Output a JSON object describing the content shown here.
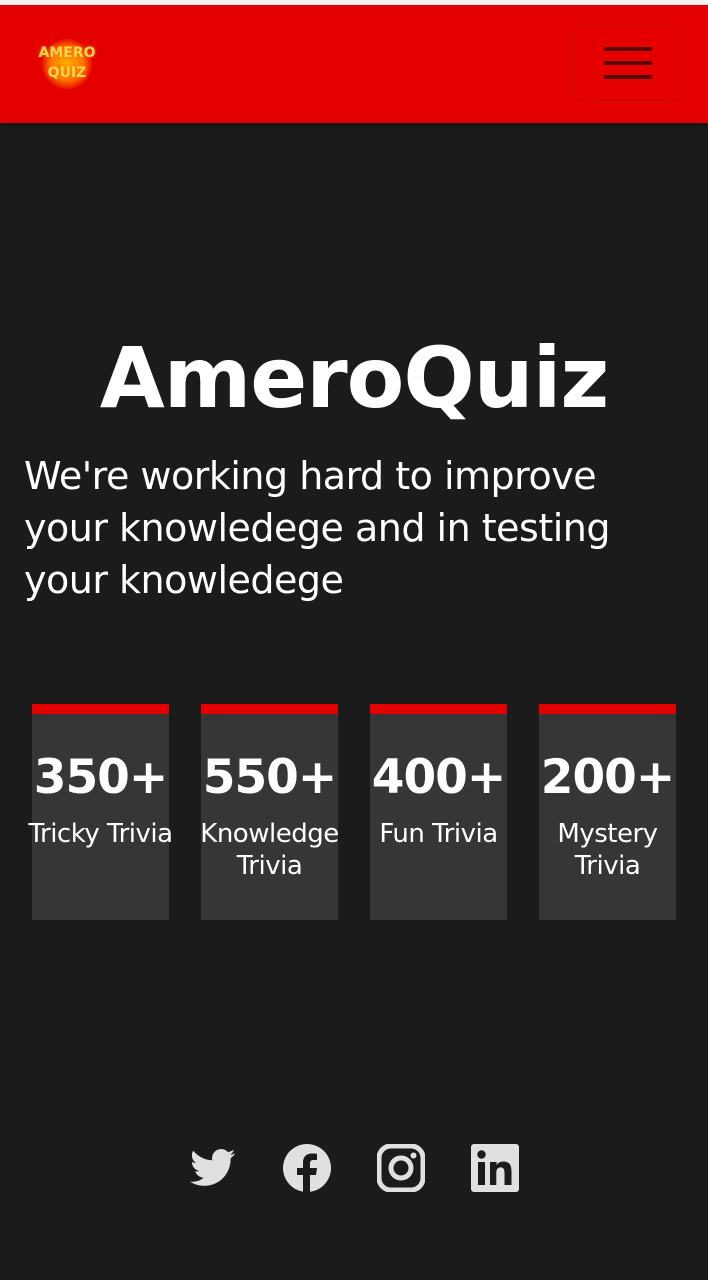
{
  "header": {
    "logo_line1": "AMERO",
    "logo_line2": "QUIZ",
    "menu_icon": "hamburger-menu-icon",
    "bar_color": "#e50000"
  },
  "hero": {
    "title": "AmeroQuiz",
    "subtitle": "We're working hard to improve your knowledege and in testing your knowledege"
  },
  "stats": [
    {
      "value": "350+",
      "label": "Tricky Trivia"
    },
    {
      "value": "550+",
      "label": "Knowledge Trivia"
    },
    {
      "value": "400+",
      "label": "Fun Trivia"
    },
    {
      "value": "200+",
      "label": "Mystery Trivia"
    }
  ],
  "social": [
    {
      "icon": "twitter-icon"
    },
    {
      "icon": "facebook-icon"
    },
    {
      "icon": "instagram-icon"
    },
    {
      "icon": "linkedin-icon"
    }
  ],
  "colors": {
    "accent": "#e50000",
    "background": "#1b1b1b",
    "card": "#363636",
    "icon": "#e0e0e0"
  }
}
